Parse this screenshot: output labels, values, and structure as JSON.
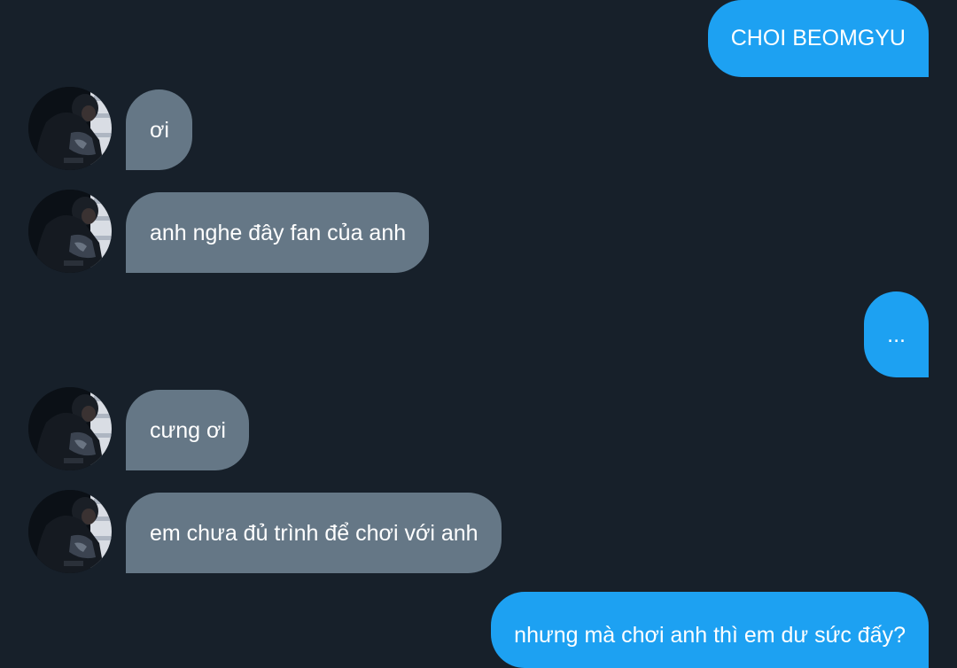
{
  "conversation": {
    "messages": [
      {
        "side": "out",
        "text": "CHOI BEOMGYU"
      },
      {
        "side": "in",
        "text": "ơi"
      },
      {
        "side": "in",
        "text": "anh nghe đây fan của anh"
      },
      {
        "side": "out",
        "text": "..."
      },
      {
        "side": "in",
        "text": "cưng ơi"
      },
      {
        "side": "in",
        "text": "em chưa đủ trình để chơi với anh"
      },
      {
        "side": "out",
        "text": "nhưng mà chơi anh thì em dư sức đấy?"
      }
    ]
  },
  "colors": {
    "background": "#17202a",
    "incoming_bubble": "#657786",
    "outgoing_bubble": "#1da1f2",
    "text": "#ffffff"
  },
  "icons": {
    "avatar": "contact-avatar-photo"
  }
}
